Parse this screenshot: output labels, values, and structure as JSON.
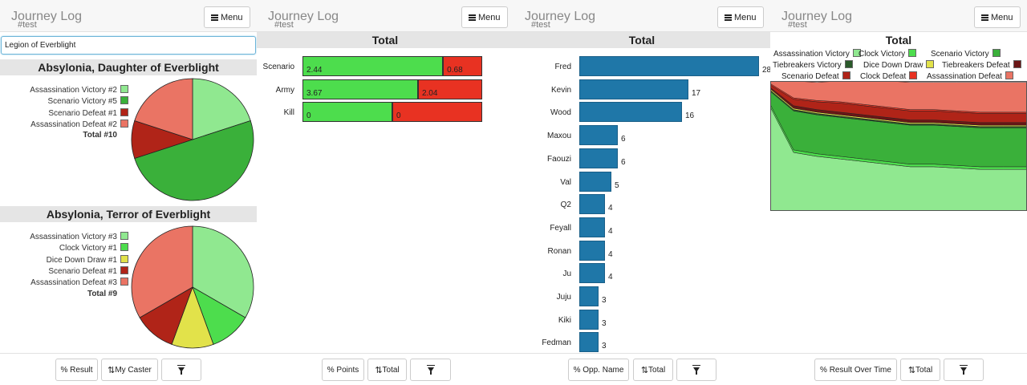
{
  "app": {
    "title": "Journey Log",
    "tag": "#test",
    "menu_label": "Menu"
  },
  "colors": {
    "assassination_victory": "#90e890",
    "clock_victory": "#4ddd4d",
    "scenario_victory": "#3ab03a",
    "tiebreakers_victory": "#2a5a2a",
    "dice_down_draw": "#e2e24a",
    "tiebreakers_defeat": "#6a1616",
    "scenario_defeat": "#b02418",
    "clock_defeat": "#e83222",
    "assassination_defeat": "#ea7464",
    "points_win": "#4ddd4d",
    "points_loss": "#e83222",
    "bar_blue": "#1f77a8"
  },
  "panel1": {
    "search": {
      "value": "Legion of Everblight"
    },
    "casters": [
      {
        "name": "Absylonia, Daughter of Everblight",
        "legend": [
          {
            "label": "Assassination Victory #2",
            "key": "assassination_victory"
          },
          {
            "label": "Scenario Victory #5",
            "key": "scenario_victory"
          },
          {
            "label": "Scenario Defeat #1",
            "key": "scenario_defeat"
          },
          {
            "label": "Assassination Defeat #2",
            "key": "assassination_defeat"
          }
        ],
        "total": "Total #10"
      },
      {
        "name": "Absylonia, Terror of Everblight",
        "legend": [
          {
            "label": "Assassination Victory #3",
            "key": "assassination_victory"
          },
          {
            "label": "Clock Victory #1",
            "key": "clock_victory"
          },
          {
            "label": "Dice Down Draw #1",
            "key": "dice_down_draw"
          },
          {
            "label": "Scenario Defeat #1",
            "key": "scenario_defeat"
          },
          {
            "label": "Assassination Defeat #3",
            "key": "assassination_defeat"
          }
        ],
        "total": "Total #9"
      }
    ],
    "footer": {
      "result": "% Result",
      "caster": "My Caster"
    }
  },
  "panel2": {
    "title": "Total",
    "footer": {
      "points": "% Points",
      "total": "Total"
    }
  },
  "panel3": {
    "title": "Total",
    "footer": {
      "opp": "% Opp. Name",
      "total": "Total"
    }
  },
  "panel4": {
    "title": "Total",
    "legend": [
      {
        "label": "Assassination Victory",
        "key": "assassination_victory"
      },
      {
        "label": "Clock Victory",
        "key": "clock_victory"
      },
      {
        "label": "Scenario Victory",
        "key": "scenario_victory"
      },
      {
        "label": "Tiebreakers Victory",
        "key": "tiebreakers_victory"
      },
      {
        "label": "Dice Down Draw",
        "key": "dice_down_draw"
      },
      {
        "label": "Tiebreakers Defeat",
        "key": "tiebreakers_defeat"
      },
      {
        "label": "Scenario Defeat",
        "key": "scenario_defeat"
      },
      {
        "label": "Clock Defeat",
        "key": "clock_defeat"
      },
      {
        "label": "Assassination Defeat",
        "key": "assassination_defeat"
      }
    ],
    "footer": {
      "over_time": "% Result Over Time",
      "total": "Total"
    }
  },
  "chart_data": [
    {
      "type": "pie",
      "title": "Absylonia, Daughter of Everblight",
      "slices": [
        {
          "label": "Assassination Victory",
          "value": 2,
          "key": "assassination_victory"
        },
        {
          "label": "Scenario Victory",
          "value": 5,
          "key": "scenario_victory"
        },
        {
          "label": "Scenario Defeat",
          "value": 1,
          "key": "scenario_defeat"
        },
        {
          "label": "Assassination Defeat",
          "value": 2,
          "key": "assassination_defeat"
        }
      ]
    },
    {
      "type": "pie",
      "title": "Absylonia, Terror of Everblight",
      "slices": [
        {
          "label": "Assassination Victory",
          "value": 3,
          "key": "assassination_victory"
        },
        {
          "label": "Clock Victory",
          "value": 1,
          "key": "clock_victory"
        },
        {
          "label": "Dice Down Draw",
          "value": 1,
          "key": "dice_down_draw"
        },
        {
          "label": "Scenario Defeat",
          "value": 1,
          "key": "scenario_defeat"
        },
        {
          "label": "Assassination Defeat",
          "value": 3,
          "key": "assassination_defeat"
        }
      ]
    },
    {
      "type": "bar",
      "title": "Total",
      "stacked": true,
      "categories": [
        "Scenario",
        "Army",
        "Kill"
      ],
      "series": [
        {
          "values": [
            2.44,
            3.67,
            0
          ],
          "labels": [
            "2.44",
            "3.67",
            "0"
          ],
          "key": "points_win"
        },
        {
          "values": [
            0.68,
            2.04,
            0
          ],
          "labels": [
            "0.68",
            "2.04",
            "0"
          ],
          "key": "points_loss"
        }
      ]
    },
    {
      "type": "bar",
      "title": "Total",
      "orientation": "horizontal",
      "categories": [
        "Fred",
        "Kevin",
        "Wood",
        "Maxou",
        "Faouzi",
        "Val",
        "Q2",
        "Feyall",
        "Ronan",
        "Ju",
        "Juju",
        "Kiki",
        "Fedman"
      ],
      "values": [
        28,
        17,
        16,
        6,
        6,
        5,
        4,
        4,
        4,
        4,
        3,
        3,
        3
      ],
      "labels": [
        "28",
        "17",
        "16",
        "6",
        "6",
        "5",
        "4",
        "4",
        "4",
        "4",
        "3",
        "3",
        "3"
      ]
    },
    {
      "type": "area",
      "title": "Total",
      "stacked": true,
      "normalized": true,
      "series": [
        {
          "name": "Assassination Victory",
          "values": [
            0.8,
            0.45,
            0.42,
            0.4,
            0.38,
            0.36,
            0.34,
            0.34,
            0.33,
            0.32,
            0.32,
            0.32
          ]
        },
        {
          "name": "Clock Victory",
          "values": [
            0.02,
            0.02,
            0.02,
            0.02,
            0.02,
            0.02,
            0.02,
            0.02,
            0.02,
            0.02,
            0.02,
            0.02
          ]
        },
        {
          "name": "Scenario Victory",
          "values": [
            0.1,
            0.3,
            0.3,
            0.3,
            0.3,
            0.3,
            0.3,
            0.3,
            0.3,
            0.3,
            0.3,
            0.3
          ]
        },
        {
          "name": "Tiebreakers Victory",
          "values": [
            0.01,
            0.01,
            0.01,
            0.01,
            0.01,
            0.01,
            0.01,
            0.01,
            0.01,
            0.01,
            0.01,
            0.01
          ]
        },
        {
          "name": "Dice Down Draw",
          "values": [
            0.01,
            0.01,
            0.01,
            0.01,
            0.01,
            0.01,
            0.01,
            0.01,
            0.01,
            0.01,
            0.01,
            0.01
          ]
        },
        {
          "name": "Tiebreakers Defeat",
          "values": [
            0.01,
            0.02,
            0.02,
            0.02,
            0.02,
            0.02,
            0.02,
            0.02,
            0.02,
            0.02,
            0.02,
            0.02
          ]
        },
        {
          "name": "Scenario Defeat",
          "values": [
            0.02,
            0.05,
            0.06,
            0.07,
            0.07,
            0.07,
            0.07,
            0.07,
            0.07,
            0.07,
            0.07,
            0.07
          ]
        },
        {
          "name": "Clock Defeat",
          "values": [
            0.01,
            0.01,
            0.01,
            0.01,
            0.01,
            0.01,
            0.01,
            0.01,
            0.01,
            0.01,
            0.01,
            0.01
          ]
        },
        {
          "name": "Assassination Defeat",
          "values": [
            0.02,
            0.13,
            0.14,
            0.16,
            0.18,
            0.2,
            0.21,
            0.21,
            0.22,
            0.23,
            0.23,
            0.23
          ]
        }
      ]
    }
  ]
}
